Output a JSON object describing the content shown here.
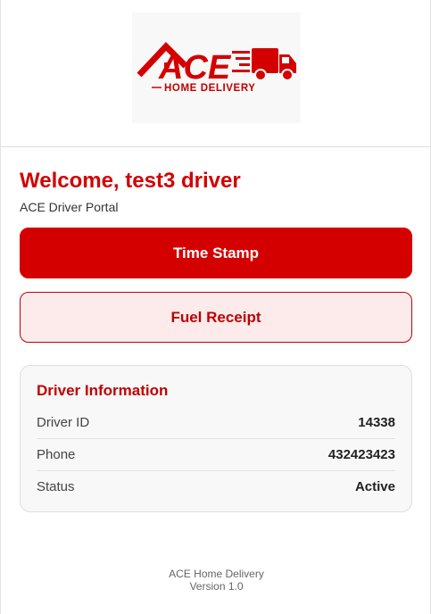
{
  "brand": {
    "logo_wordmark": "ACE",
    "logo_tagline": "HOME DELIVERY",
    "accent_color": "#d40000",
    "logo_icons": [
      "house-icon",
      "delivery-truck-icon"
    ]
  },
  "welcome": {
    "title": "Welcome, test3 driver",
    "subtitle": "ACE Driver Portal"
  },
  "actions": {
    "time_stamp_label": "Time Stamp",
    "fuel_receipt_label": "Fuel Receipt"
  },
  "driver_info": {
    "title": "Driver Information",
    "rows": [
      {
        "label": "Driver ID",
        "value": "14338"
      },
      {
        "label": "Phone",
        "value": "432423423"
      },
      {
        "label": "Status",
        "value": "Active"
      }
    ]
  },
  "footer": {
    "company": "ACE Home Delivery",
    "version": "Version 1.0"
  }
}
